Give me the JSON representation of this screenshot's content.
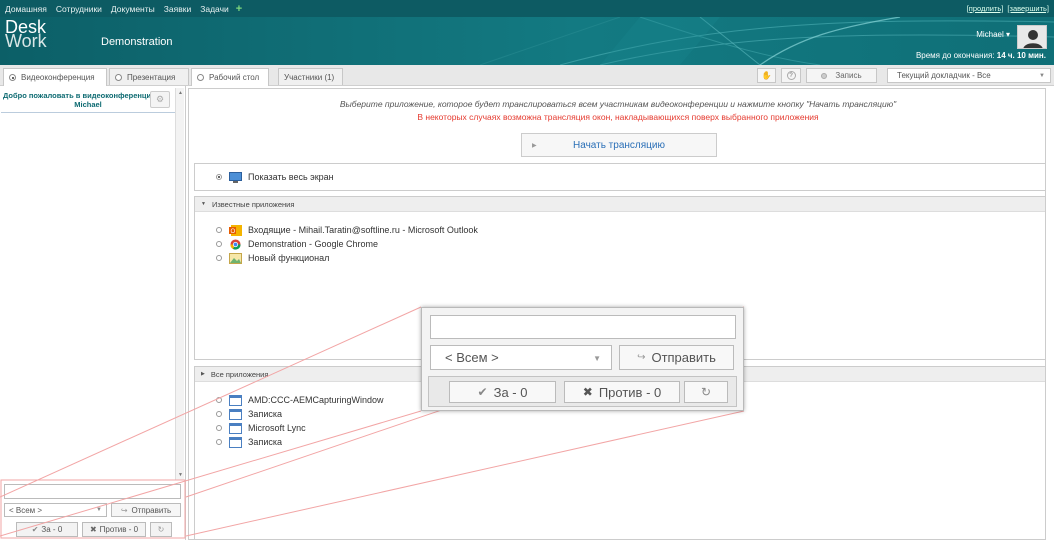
{
  "topnav": {
    "items": [
      "Домашняя",
      "Сотрудники",
      "Документы",
      "Заявки",
      "Задачи"
    ],
    "add_icon": "+",
    "extend_link": "[продлить]",
    "finish_link": "[завершить]"
  },
  "header": {
    "logo_line1": "Desk",
    "logo_line2": "Work",
    "title": "Demonstration",
    "user_name": "Michael ▾",
    "time_left_label": "Время до окончания:",
    "time_left_value": "14 ч. 10 мин."
  },
  "tabs": [
    {
      "label": "Видеоконференция"
    },
    {
      "label": "Презентация"
    },
    {
      "label": "Рабочий стол"
    },
    {
      "label": "Участники (1)"
    }
  ],
  "toolbar": {
    "hand_icon": "✋",
    "help_icon": "?",
    "record_label": "Запись",
    "speaker_label": "Текущий докладчик - Все"
  },
  "chat": {
    "welcome_line1": "Добро пожаловать в видеоконференцию,",
    "welcome_line2": "Michael",
    "recipient": "< Всем >",
    "send_label": "Отправить",
    "for_label": "За - 0",
    "against_label": "Против - 0"
  },
  "main": {
    "instruction": "Выберите приложение, которое будет транслироваться всем участникам видеоконференции и нажмите кнопку \"Начать трансляцию\"",
    "warning": "В некоторых случаях возможна трансляция окон, накладывающихся поверх выбранного приложения",
    "start_label": "Начать трансляцию",
    "full_screen_label": "Показать весь экран",
    "known_header": "Известные приложения",
    "known_apps": [
      "Входящие - Mihail.Taratin@softline.ru - Microsoft Outlook",
      "Demonstration - Google Chrome",
      "Новый функционал"
    ],
    "all_header": "Все приложения",
    "all_apps": [
      "AMD:CCC-AEMCapturingWindow",
      "Записка",
      "Microsoft Lync",
      "Записка"
    ]
  },
  "popup": {
    "recipient": "< Всем >",
    "send_label": "Отправить",
    "for_label": "За - 0",
    "against_label": "Против - 0"
  },
  "colors": {
    "topnav": "#0d5b63",
    "banner": "#137a82",
    "warning": "#e53a2f",
    "link": "#2a6fb7"
  }
}
